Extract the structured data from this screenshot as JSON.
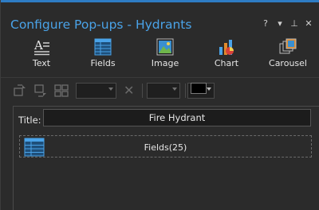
{
  "window": {
    "title": "Configure Pop-ups - Hydrants",
    "controls": [
      "?",
      "▾",
      "⊥",
      "✕"
    ]
  },
  "ribbon": {
    "items": [
      {
        "label": "Text",
        "icon": "text-element-icon"
      },
      {
        "label": "Fields",
        "icon": "fields-table-icon"
      },
      {
        "label": "Image",
        "icon": "image-icon"
      },
      {
        "label": "Chart",
        "icon": "chart-icon"
      },
      {
        "label": "Carousel",
        "icon": "carousel-icon"
      }
    ]
  },
  "toolbar": {
    "font_size_value": "",
    "font_family_value": "",
    "color_value": "#000000"
  },
  "popup": {
    "title_label": "Title:",
    "title_value": "Fire Hydrant",
    "elements": [
      {
        "label": "Fields(25)",
        "icon": "fields-table-icon"
      }
    ]
  },
  "colors": {
    "accent": "#2e7cc4",
    "title_text": "#4aa3e8",
    "background": "#2b2b2b"
  }
}
